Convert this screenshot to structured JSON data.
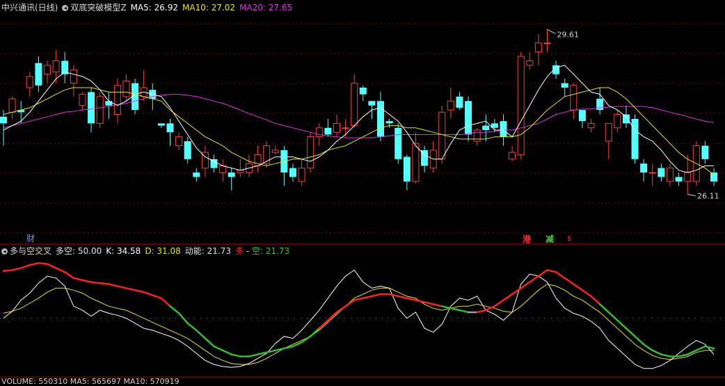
{
  "header_main": {
    "stock": "中兴通讯(日线)",
    "indicator": "双底突破模型Z",
    "ma5": "MA5: 26.92",
    "ma10": "MA10: 27.02",
    "ma20": "MA20: 27.65"
  },
  "header_sub": {
    "indicator": "多与空交叉",
    "duokong": "多空: 50.00",
    "k": "K: 34.58",
    "d": "D: 31.08",
    "dongneng": "动能: 21.73",
    "duo": "多",
    "sep": " - ",
    "kong": "空: 21.73"
  },
  "header_vol": {
    "text": "VOLUME: 550310  MA5: 565697  MA10: 570919"
  },
  "markers": {
    "cai": "财",
    "gang": "港",
    "jian": "减",
    "dollar": "$"
  },
  "colors": {
    "up": "#ff3c3c",
    "down": "#54ffff",
    "ma5": "#ffffff",
    "ma10": "#e6e600",
    "ma20": "#e030e0",
    "duo": "#ff2020",
    "kong": "#30c030",
    "neutral": "#a0a0a0"
  },
  "chart_data": {
    "type": "candlestick",
    "ylim": [
      25.2,
      30.15
    ],
    "annotations": {
      "high": "29.61",
      "low": "26.11"
    },
    "candles": [
      [
        27.85,
        27.7,
        28.0,
        27.2
      ],
      [
        27.95,
        28.25,
        28.3,
        27.8
      ],
      [
        28.0,
        27.95,
        28.2,
        27.7
      ],
      [
        28.5,
        28.75,
        28.85,
        28.3
      ],
      [
        29.05,
        28.55,
        29.2,
        28.4
      ],
      [
        28.8,
        29.0,
        29.1,
        28.6
      ],
      [
        28.85,
        29.1,
        29.35,
        28.6
      ],
      [
        29.1,
        28.8,
        29.3,
        28.6
      ],
      [
        28.6,
        28.9,
        29.0,
        28.3
      ],
      [
        28.1,
        28.35,
        28.4,
        28.0
      ],
      [
        28.4,
        27.7,
        28.5,
        27.5
      ],
      [
        27.7,
        28.3,
        28.4,
        27.6
      ],
      [
        28.2,
        28.1,
        28.4,
        27.8
      ],
      [
        27.9,
        28.55,
        28.7,
        27.7
      ],
      [
        28.3,
        28.65,
        28.8,
        28.2
      ],
      [
        28.6,
        28.0,
        28.7,
        27.9
      ],
      [
        28.3,
        28.5,
        28.9,
        28.2
      ],
      [
        28.45,
        28.25,
        28.6,
        28.0
      ],
      [
        27.7,
        27.65,
        27.7,
        27.6
      ],
      [
        27.7,
        27.5,
        27.8,
        27.2
      ],
      [
        27.2,
        27.4,
        27.5,
        27.1
      ],
      [
        27.3,
        26.9,
        27.4,
        26.8
      ],
      [
        26.6,
        26.5,
        26.7,
        26.4
      ],
      [
        26.7,
        27.05,
        27.2,
        26.5
      ],
      [
        26.9,
        26.7,
        27.0,
        26.6
      ],
      [
        26.6,
        26.75,
        26.9,
        26.4
      ],
      [
        26.6,
        26.5,
        26.7,
        26.2
      ],
      [
        26.6,
        26.65,
        26.9,
        26.5
      ],
      [
        26.6,
        26.8,
        27.0,
        26.5
      ],
      [
        26.75,
        27.0,
        27.2,
        26.6
      ],
      [
        26.8,
        27.2,
        27.3,
        26.7
      ],
      [
        27.05,
        27.1,
        27.2,
        27.0
      ],
      [
        27.1,
        26.6,
        27.2,
        26.3
      ],
      [
        26.7,
        26.5,
        26.8,
        26.4
      ],
      [
        26.4,
        26.7,
        26.9,
        26.3
      ],
      [
        26.7,
        27.4,
        27.5,
        26.6
      ],
      [
        27.4,
        27.6,
        27.7,
        27.2
      ],
      [
        27.6,
        27.45,
        27.8,
        27.4
      ],
      [
        27.5,
        27.7,
        27.9,
        27.4
      ],
      [
        27.6,
        27.6,
        27.8,
        27.4
      ],
      [
        27.65,
        28.6,
        28.8,
        27.6
      ],
      [
        28.5,
        28.35,
        28.55,
        28.2
      ],
      [
        28.2,
        28.1,
        28.2,
        27.8
      ],
      [
        28.2,
        27.4,
        28.4,
        27.3
      ],
      [
        27.75,
        27.7,
        27.8,
        27.6
      ],
      [
        27.6,
        26.9,
        27.7,
        26.8
      ],
      [
        26.95,
        26.4,
        27.0,
        26.2
      ],
      [
        26.4,
        27.25,
        27.5,
        26.35
      ],
      [
        27.1,
        26.75,
        27.2,
        26.6
      ],
      [
        26.7,
        27.1,
        27.3,
        26.6
      ],
      [
        26.9,
        27.95,
        28.1,
        26.8
      ],
      [
        28.0,
        28.2,
        28.5,
        27.8
      ],
      [
        28.3,
        28.05,
        28.4,
        28.0
      ],
      [
        28.2,
        27.45,
        28.3,
        27.3
      ],
      [
        27.3,
        27.55,
        27.6,
        27.2
      ],
      [
        27.65,
        27.55,
        27.9,
        27.3
      ],
      [
        27.7,
        27.6,
        27.8,
        27.5
      ],
      [
        27.75,
        27.4,
        27.9,
        27.2
      ],
      [
        26.9,
        27.05,
        27.2,
        26.85
      ],
      [
        27.0,
        29.2,
        29.3,
        26.9
      ],
      [
        29.0,
        29.1,
        29.3,
        28.9
      ],
      [
        29.3,
        29.5,
        29.7,
        29.0
      ],
      [
        29.5,
        29.5,
        29.8,
        29.3
      ],
      [
        29.0,
        28.8,
        29.1,
        28.7
      ],
      [
        28.6,
        28.5,
        28.7,
        28.3
      ],
      [
        28.0,
        28.55,
        28.6,
        27.8
      ],
      [
        28.0,
        27.75,
        28.0,
        27.6
      ],
      [
        27.6,
        27.7,
        27.8,
        27.5
      ],
      [
        28.25,
        28.0,
        28.5,
        27.9
      ],
      [
        27.3,
        27.7,
        27.7,
        26.9
      ],
      [
        27.6,
        27.9,
        28.0,
        27.5
      ],
      [
        27.9,
        27.7,
        28.1,
        27.6
      ],
      [
        27.8,
        26.9,
        27.9,
        26.8
      ],
      [
        26.8,
        26.6,
        26.9,
        26.4
      ],
      [
        26.6,
        26.6,
        26.8,
        26.3
      ],
      [
        26.7,
        26.5,
        26.8,
        26.4
      ],
      [
        26.4,
        26.7,
        26.8,
        26.3
      ],
      [
        26.5,
        26.4,
        26.6,
        26.3
      ],
      [
        26.4,
        26.6,
        27.0,
        26.11
      ],
      [
        26.4,
        27.2,
        27.3,
        26.3
      ],
      [
        27.2,
        26.9,
        27.3,
        26.8
      ],
      [
        26.6,
        26.4,
        26.7,
        26.3
      ]
    ],
    "ma5": [
      27.55,
      27.65,
      27.75,
      27.95,
      28.2,
      28.45,
      28.7,
      28.85,
      28.8,
      28.75,
      28.65,
      28.45,
      28.2,
      28.1,
      28.2,
      28.35,
      28.4,
      28.35,
      28.3,
      28.05,
      27.75,
      27.45,
      27.15,
      26.95,
      26.85,
      26.75,
      26.7,
      26.65,
      26.7,
      26.75,
      26.85,
      26.95,
      26.95,
      26.95,
      26.9,
      26.85,
      26.95,
      27.1,
      27.3,
      27.45,
      27.65,
      27.85,
      28.0,
      28.05,
      27.9,
      27.75,
      27.5,
      27.2,
      27.0,
      26.9,
      26.9,
      27.25,
      27.55,
      27.65,
      27.7,
      27.75,
      27.55,
      27.55,
      27.4,
      27.75,
      28.1,
      28.45,
      28.75,
      28.95,
      29.0,
      28.8,
      28.6,
      28.4,
      28.35,
      28.1,
      28.0,
      27.85,
      27.55,
      27.4,
      27.3,
      27.1,
      26.85,
      26.65,
      26.6,
      26.65,
      26.75,
      26.75
    ],
    "ma10": [
      27.9,
      27.95,
      28.0,
      28.05,
      28.15,
      28.25,
      28.35,
      28.45,
      28.5,
      28.5,
      28.5,
      28.45,
      28.4,
      28.4,
      28.4,
      28.35,
      28.3,
      28.25,
      28.2,
      28.0,
      27.85,
      27.7,
      27.55,
      27.4,
      27.3,
      27.2,
      27.05,
      26.95,
      26.85,
      26.8,
      26.75,
      26.8,
      26.85,
      26.9,
      26.9,
      26.95,
      27.0,
      27.1,
      27.15,
      27.2,
      27.3,
      27.4,
      27.5,
      27.6,
      27.65,
      27.65,
      27.6,
      27.6,
      27.55,
      27.5,
      27.45,
      27.4,
      27.35,
      27.35,
      27.35,
      27.35,
      27.4,
      27.4,
      27.4,
      27.45,
      27.6,
      27.8,
      28.0,
      28.15,
      28.3,
      28.35,
      28.4,
      28.45,
      28.5,
      28.5,
      28.4,
      28.25,
      28.05,
      27.85,
      27.65,
      27.45,
      27.25,
      27.05,
      26.9,
      26.8,
      26.7,
      26.55
    ],
    "ma20": [
      27.6,
      27.65,
      27.7,
      27.75,
      27.8,
      27.85,
      27.9,
      27.95,
      27.97,
      28.0,
      28.02,
      28.05,
      28.08,
      28.12,
      28.15,
      28.2,
      28.25,
      28.3,
      28.33,
      28.35,
      28.35,
      28.33,
      28.3,
      28.25,
      28.2,
      28.15,
      28.08,
      28.0,
      27.92,
      27.85,
      27.78,
      27.7,
      27.65,
      27.6,
      27.55,
      27.5,
      27.45,
      27.42,
      27.4,
      27.38,
      27.38,
      27.38,
      27.38,
      27.4,
      27.42,
      27.45,
      27.45,
      27.45,
      27.45,
      27.45,
      27.45,
      27.45,
      27.45,
      27.47,
      27.5,
      27.5,
      27.52,
      27.55,
      27.55,
      27.6,
      27.65,
      27.7,
      27.8,
      27.9,
      27.95,
      28.0,
      28.02,
      28.02,
      28.05,
      28.06,
      28.08,
      28.08,
      28.08,
      28.08,
      28.05,
      28.0,
      27.95,
      27.9,
      27.85,
      27.8,
      27.75,
      27.72
    ],
    "sub": {
      "ylim": [
        -5,
        110
      ],
      "dotted_level": 50,
      "k": [
        50,
        57,
        68,
        75,
        85,
        92,
        90,
        82,
        62,
        58,
        52,
        58,
        55,
        53,
        50,
        45,
        40,
        38,
        35,
        32,
        28,
        22,
        15,
        8,
        4,
        2,
        1,
        2,
        5,
        10,
        15,
        25,
        32,
        30,
        38,
        48,
        58,
        70,
        82,
        92,
        98,
        86,
        80,
        82,
        80,
        60,
        50,
        56,
        40,
        36,
        44,
        62,
        70,
        68,
        72,
        58,
        54,
        48,
        56,
        84,
        94,
        92,
        86,
        70,
        60,
        55,
        52,
        47,
        40,
        28,
        20,
        12,
        4,
        0,
        0,
        3,
        8,
        15,
        22,
        28,
        24,
        14
      ],
      "d": [
        55,
        57,
        60,
        65,
        70,
        76,
        80,
        80,
        78,
        75,
        70,
        66,
        62,
        60,
        58,
        54,
        50,
        46,
        42,
        38,
        34,
        30,
        24,
        18,
        12,
        8,
        5,
        4,
        4,
        6,
        10,
        15,
        20,
        24,
        28,
        32,
        38,
        46,
        54,
        62,
        70,
        74,
        78,
        80,
        80,
        76,
        72,
        70,
        64,
        60,
        58,
        60,
        62,
        62,
        64,
        62,
        60,
        57,
        56,
        62,
        70,
        78,
        84,
        82,
        78,
        72,
        68,
        62,
        56,
        48,
        40,
        32,
        24,
        18,
        13,
        10,
        9,
        10,
        12,
        16,
        18,
        18
      ],
      "kd": [
        97,
        98,
        100,
        103,
        105,
        104,
        100,
        96,
        90,
        88,
        86,
        85,
        84,
        82,
        80,
        78,
        76,
        73,
        70,
        62,
        55,
        45,
        38,
        30,
        22,
        18,
        14,
        12,
        12,
        14,
        16,
        18,
        20,
        22,
        26,
        32,
        40,
        48,
        56,
        62,
        68,
        70,
        72,
        74,
        74,
        72,
        70,
        68,
        66,
        64,
        62,
        60,
        58,
        56,
        56,
        58,
        62,
        68,
        74,
        80,
        86,
        92,
        98,
        96,
        90,
        84,
        78,
        72,
        64,
        56,
        48,
        40,
        32,
        24,
        18,
        14,
        12,
        12,
        14,
        18,
        22,
        20
      ]
    }
  }
}
